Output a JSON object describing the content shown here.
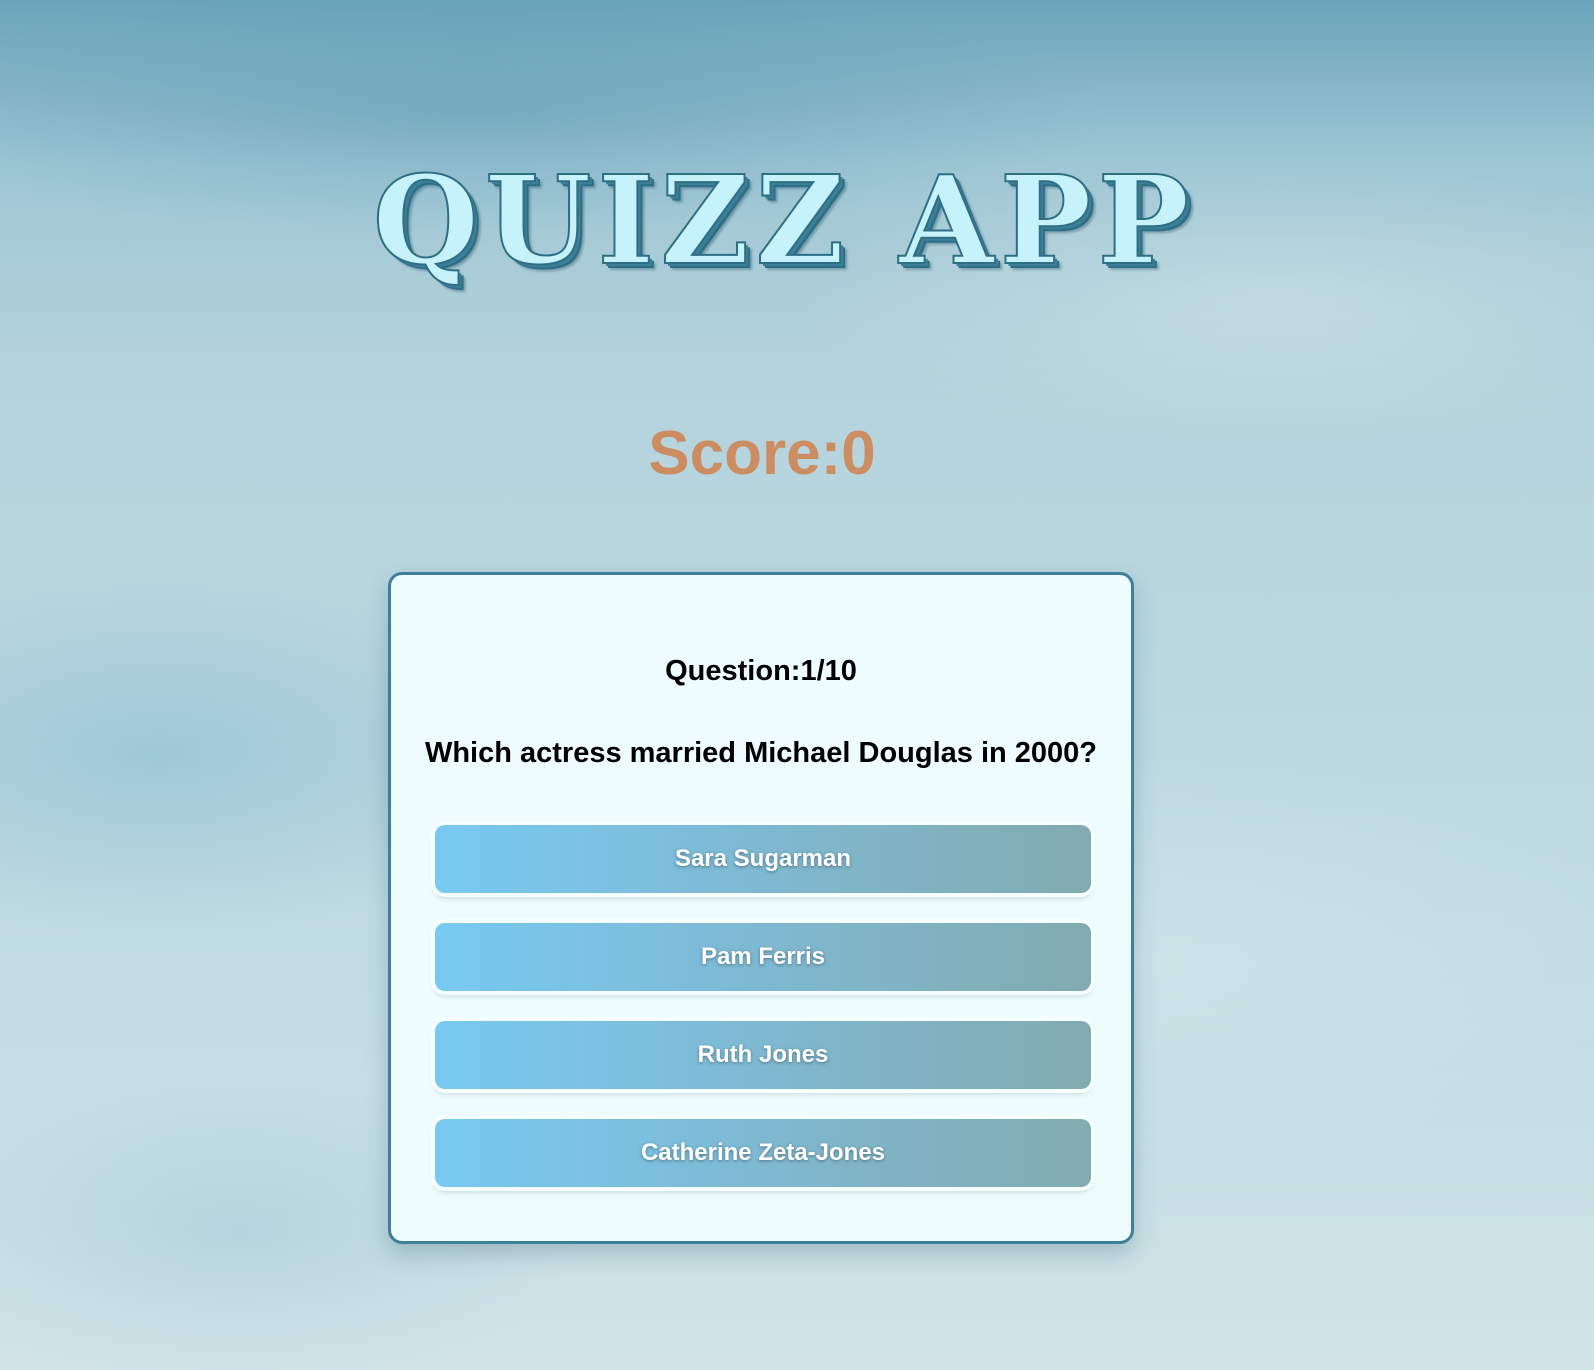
{
  "app": {
    "title": "QUIZZ APP"
  },
  "score": {
    "text": "Score:0"
  },
  "quiz": {
    "counter": "Question:1/10",
    "question": "Which actress married Michael Douglas in 2000?",
    "answers": [
      {
        "label": "Sara Sugarman"
      },
      {
        "label": "Pam Ferris"
      },
      {
        "label": "Ruth Jones"
      },
      {
        "label": "Catherine Zeta-Jones"
      }
    ]
  },
  "colors": {
    "title_fill": "#c6f2fb",
    "title_outline": "#2f6f86",
    "score": "#cd8d63",
    "card_background": "#eefcfd",
    "card_border": "#3f7f99",
    "button_gradient_start": "#78c9f2",
    "button_gradient_end": "#82abb0"
  }
}
